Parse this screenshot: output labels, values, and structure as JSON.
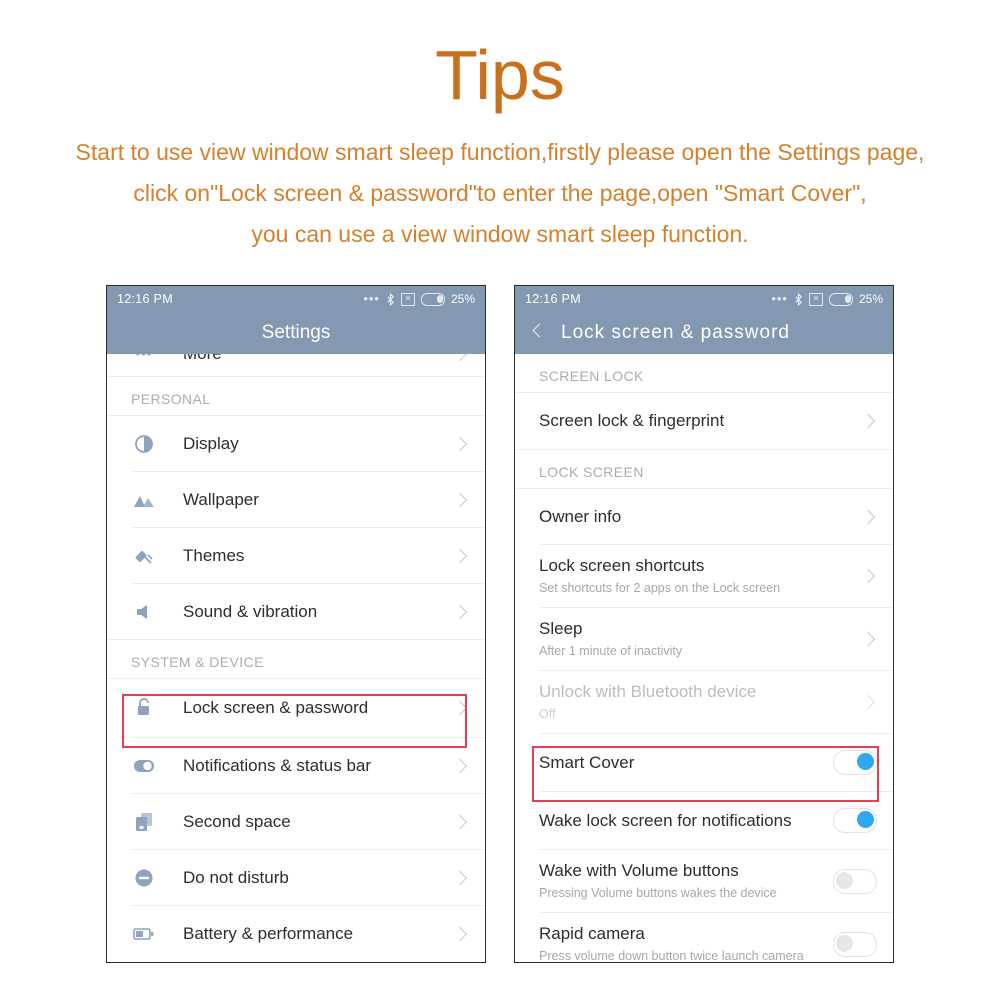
{
  "header": {
    "title": "Tips",
    "intro_lines": [
      "Start to use view window smart sleep function,firstly please open the Settings page,",
      "click on\"Lock screen & password\"to enter the page,open \"Smart Cover\",",
      "you can use a view window smart sleep function."
    ],
    "title_color": "#c9711a",
    "text_color": "#d4802c"
  },
  "colors": {
    "status_bar": "#8498b2",
    "highlight_border": "#e4404f",
    "toggle_on": "#2fa8f0",
    "icon": "#8fa3bd"
  },
  "left_phone": {
    "status": {
      "clock": "12:16  PM",
      "battery_percent": "25%",
      "icons": [
        "more-dots-icon",
        "bluetooth-icon",
        "no-sim-icon",
        "battery-icon"
      ]
    },
    "title": "Settings",
    "partial_row": {
      "label": "More",
      "icon": "more-dots-icon"
    },
    "sections": [
      {
        "label": "PERSONAL",
        "rows": [
          {
            "label": "Display",
            "icon": "contrast-icon"
          },
          {
            "label": "Wallpaper",
            "icon": "mountains-icon"
          },
          {
            "label": "Themes",
            "icon": "paint-roller-icon"
          },
          {
            "label": "Sound & vibration",
            "icon": "speaker-icon"
          }
        ]
      },
      {
        "label": "SYSTEM & DEVICE",
        "rows": [
          {
            "label": "Lock screen & password",
            "icon": "lock-icon",
            "highlighted": true
          },
          {
            "label": "Notifications & status bar",
            "icon": "notification-toggle-icon"
          },
          {
            "label": "Second space",
            "icon": "second-space-icon"
          },
          {
            "label": "Do not disturb",
            "icon": "do-not-disturb-icon"
          },
          {
            "label": "Battery & performance",
            "icon": "battery-icon"
          }
        ]
      }
    ]
  },
  "right_phone": {
    "status": {
      "clock": "12:16  PM",
      "battery_percent": "25%",
      "icons": [
        "more-dots-icon",
        "bluetooth-icon",
        "no-sim-icon",
        "battery-icon"
      ]
    },
    "title": "Lock  screen  &  password",
    "back": "back-chevron-icon",
    "sections": [
      {
        "label": "SCREEN LOCK",
        "rows": [
          {
            "label": "Screen lock & fingerprint",
            "type": "chevron"
          }
        ]
      },
      {
        "label": "LOCK SCREEN",
        "rows": [
          {
            "label": "Owner info",
            "type": "chevron"
          },
          {
            "label": "Lock screen shortcuts",
            "sub": "Set shortcuts for 2 apps on the Lock screen",
            "type": "chevron"
          },
          {
            "label": "Sleep",
            "sub": "After 1 minute of inactivity",
            "type": "chevron"
          },
          {
            "label": "Unlock with Bluetooth device",
            "sub": "Off",
            "type": "chevron",
            "disabled": true
          },
          {
            "label": "Smart Cover",
            "type": "toggle",
            "toggle": "on",
            "highlighted": true
          },
          {
            "label": "Wake lock screen for notifications",
            "type": "toggle",
            "toggle": "on"
          },
          {
            "label": "Wake with Volume buttons",
            "sub": "Pressing Volume buttons wakes the device",
            "type": "toggle",
            "toggle": "off"
          },
          {
            "label": "Rapid camera",
            "sub": "Press volume down button twice launch camera",
            "type": "toggle",
            "toggle": "off"
          }
        ]
      }
    ]
  }
}
